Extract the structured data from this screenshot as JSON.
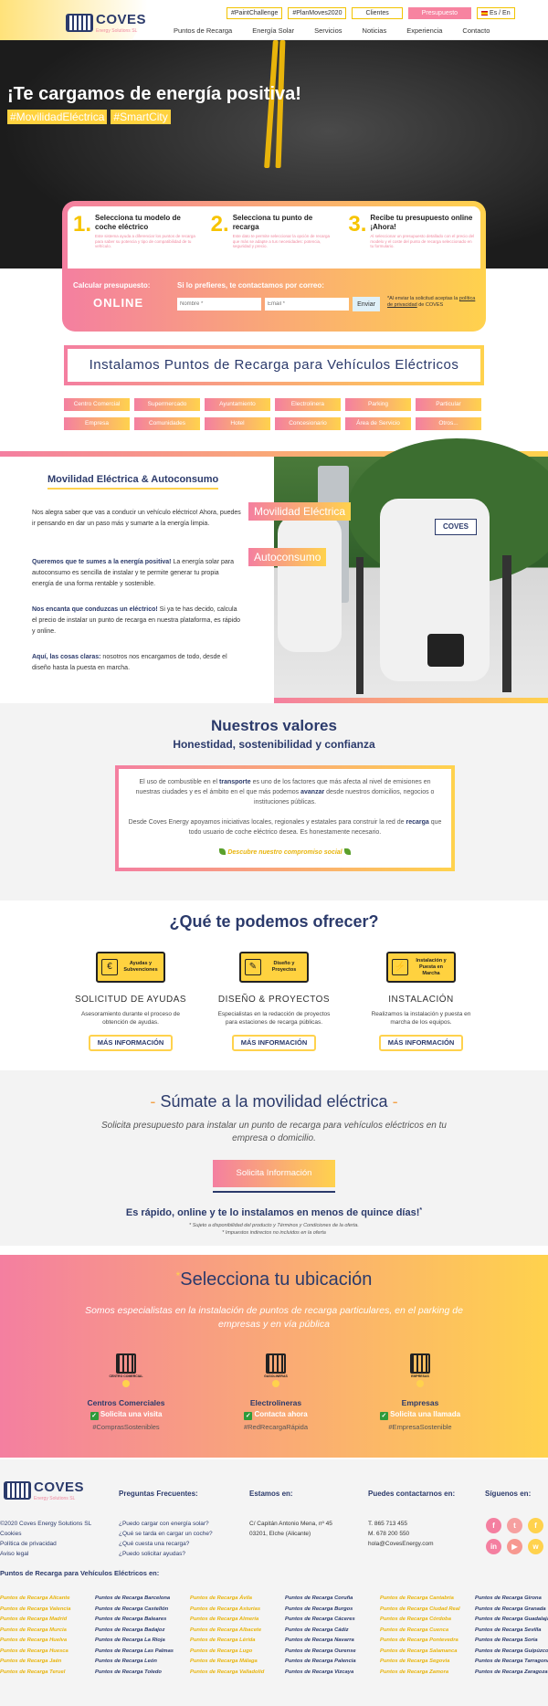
{
  "header": {
    "logo_text": "COVES",
    "logo_sub": "Energy Solutions SL",
    "top_buttons": [
      "#PaintChallenge",
      "#PlanMoves2020",
      "Clientes",
      "Presupuesto"
    ],
    "lang": "Es / En",
    "nav": [
      "Puntos de Recarga",
      "Energía Solar",
      "Servicios",
      "Noticias",
      "Experiencia",
      "Contacto"
    ]
  },
  "hero": {
    "title": "¡Te cargamos de energía positiva!",
    "tags": [
      "#MovilidadEléctrica",
      "#SmartCity"
    ]
  },
  "calculator": {
    "steps": [
      {
        "num": "1.",
        "title": "Selecciona tu modelo de coche eléctrico",
        "desc": "Este sistema ayuda a diferenciar los puntos de recarga para saber su potencia y tipo de compatibilidad de tu vehículo."
      },
      {
        "num": "2.",
        "title": "Selecciona tu punto de recarga",
        "desc": "Este dato te permite seleccionar la opción de recarga que más se adapte a tus necesidades: potencia, seguridad y precio."
      },
      {
        "num": "3.",
        "title": "Recibe tu presupuesto online ¡Ahora!",
        "desc": "Al seleccionar un presupuesto detallado con el precio del modelo y el coste del punto de recarga seleccionado en tu formulario."
      }
    ],
    "calc_label": "Calcular presupuesto:",
    "online": "ONLINE",
    "contact_label": "Si lo prefieres, te contactamos por correo:",
    "name_placeholder": "Nombre *",
    "email_placeholder": "Email *",
    "send": "Enviar",
    "note": "*Al enviar la solicitud aceptas la",
    "note_link": "política de privacidad",
    "note_end": "de COVES"
  },
  "instalamos": {
    "title": "Instalamos Puntos de Recarga para Vehículos Eléctricos",
    "categories": [
      "Centro Comercial",
      "Supermercado",
      "Ayuntamiento",
      "Electrolinera",
      "Parking",
      "Particular",
      "Empresa",
      "Comunidades",
      "Hotel",
      "Concesionario",
      "Área de Servicio",
      "Otros..."
    ]
  },
  "movilidad": {
    "title": "Movilidad Eléctrica & Autoconsumo",
    "p1": "Nos alegra saber que vas a conducir un vehículo eléctrico! Ahora, puedes ir pensando en dar un paso más y sumarte a la energía limpia.",
    "p2_bold": "Queremos que te sumes a la energía positiva!",
    "p2": " La energía solar para autoconsumo es sencilla de instalar y te permite generar tu propia energía de una forma rentable y sostenible.",
    "p3_bold": "Nos encanta que conduzcas un eléctrico!",
    "p3": " Si ya te has decido, calcula el precio de instalar un punto de recarga en nuestra plataforma, es rápido y online.",
    "p4_bold": "Aquí, las cosas claras:",
    "p4": " nosotros nos encargamos de todo, desde el diseño hasta la puesta en marcha.",
    "tag1": "Movilidad Eléctrica",
    "tag2": "Autoconsumo",
    "image_logo": "COVES"
  },
  "valores": {
    "title": "Nuestros valores",
    "subtitle": "Honestidad, sostenibilidad y confianza",
    "p1a": "El uso de combustible en el ",
    "p1b": "transporte",
    "p1c": " es uno de los factores que más afecta al nivel de emisiones en nuestras ciudades y es el ámbito en el que más podemos ",
    "p1d": "avanzar",
    "p1e": " desde nuestros domicilios, negocios o instituciones públicas.",
    "p2a": "Desde Coves Energy apoyamos iniciativas locales, regionales y estatales para construir la red de ",
    "p2b": "recarga",
    "p2c": " que todo usuario de coche eléctrico desea. Es honestamente necesario.",
    "link": "Descubre nuestro compromiso social"
  },
  "ofrecer": {
    "title": "¿Qué te podemos ofrecer?",
    "items": [
      {
        "icon_label": "Ayudas y Subvenciones",
        "glyph": "€",
        "head": "SOLICITUD DE AYUDAS",
        "desc": "Asesoramiento durante el proceso de obtención de ayudas.",
        "btn": "MÁS INFORMACIÓN"
      },
      {
        "icon_label": "Diseño y Proyectos",
        "glyph": "✎",
        "head": "DISEÑO & PROYECTOS",
        "desc": "Especialistas en la redacción de proyectos para estaciones de recarga públicas.",
        "btn": "MÁS INFORMACIÓN"
      },
      {
        "icon_label": "Instalación y Puesta en Marcha",
        "glyph": "⚡",
        "head": "INSTALACIÓN",
        "desc": "Realizamos la instalación y puesta en marcha de los equipos.",
        "btn": "MÁS INFORMACIÓN"
      }
    ]
  },
  "sumate": {
    "dash": "-",
    "title": "Súmate a la movilidad eléctrica",
    "desc": "Solicita presupuesto para instalar un punto de recarga para vehículos eléctricos en tu empresa o domicilio.",
    "button": "Solicita Información",
    "fast": "Es rápido, online y te lo instalamos en menos de quince días!",
    "fast_mark": "*",
    "note1": "* Sujeto a disponibilidad del producto y Términos y Condiciones de la oferta.",
    "note2": "* Impuestos indirectos no incluidos en la oferta"
  },
  "ubicacion": {
    "star": "*",
    "title": "Selecciona tu ubicación",
    "desc": "Somos especialistas en la instalación de puntos de recarga particulares, en el parking de empresas y en vía pública",
    "items": [
      {
        "icon_label": "CENTRO COMERCIAL",
        "name": "Centros Comerciales",
        "action": "Solicita una visita",
        "hash": "#ComprasSostenibles"
      },
      {
        "icon_label": "GASOLINERAS",
        "name": "Electrolineras",
        "action": "Contacta ahora",
        "hash": "#RedRecargaRápida"
      },
      {
        "icon_label": "EMPRESAS",
        "name": "Empresas",
        "action": "Solicita una llamada",
        "hash": "#EmpresaSostenible"
      }
    ],
    "check": "✓"
  },
  "footer": {
    "logo_text": "COVES",
    "logo_sub": "Energy Solutions SL",
    "col1": [
      "©2020 Coves Energy Solutions SL",
      "Cookies",
      "Política de privacidad",
      "Aviso legal"
    ],
    "faq_title": "Preguntas Frecuentes:",
    "faq": [
      "¿Puedo cargar con energía solar?",
      "¿Qué se tarda en cargar un coche?",
      "¿Qué cuesta una recarga?",
      "¿Puedo solicitar ayudas?"
    ],
    "addr_title": "Estamos en:",
    "addr": [
      "C/ Capitán Antonio Mena, nº 45",
      "03201, Elche (Alicante)"
    ],
    "contact_title": "Puedes contactarnos en:",
    "contact": [
      "T. 865 713 455",
      "M. 678 200 550",
      "hola@CovesEnergy.com"
    ],
    "social_title": "Síguenos en:",
    "social": [
      {
        "icon": "flickr-icon",
        "glyph": "f",
        "color": "#f47fa0"
      },
      {
        "icon": "twitter-icon",
        "glyph": "t",
        "color": "#f6a0a0"
      },
      {
        "icon": "facebook-icon",
        "glyph": "f",
        "color": "#ffd24d"
      },
      {
        "icon": "linkedin-icon",
        "glyph": "in",
        "color": "#f47fa0"
      },
      {
        "icon": "youtube-icon",
        "glyph": "▶",
        "color": "#f79890"
      },
      {
        "icon": "whatsapp-icon",
        "glyph": "w",
        "color": "#ffd24d"
      }
    ],
    "ptr_title": "Puntos de Recarga para Vehículos Eléctricos en:",
    "ptr": [
      "Puntos de Recarga Alicante",
      "Puntos de Recarga Barcelona",
      "Puntos de Recarga Ávila",
      "Puntos de Recarga Coruña",
      "Puntos de Recarga Cantabria",
      "Puntos de Recarga Girona",
      "Puntos de Recarga Valencia",
      "Puntos de Recarga Castellón",
      "Puntos de Recarga Asturias",
      "Puntos de Recarga Burgos",
      "Puntos de Recarga Ciudad Real",
      "Puntos de Recarga Granada",
      "Puntos de Recarga Madrid",
      "Puntos de Recarga Baleares",
      "Puntos de Recarga Almería",
      "Puntos de Recarga Cáceres",
      "Puntos de Recarga Córdoba",
      "Puntos de Recarga Guadalajara",
      "Puntos de Recarga Murcia",
      "Puntos de Recarga Badajoz",
      "Puntos de Recarga Albacete",
      "Puntos de Recarga Cádiz",
      "Puntos de Recarga Cuenca",
      "Puntos de Recarga Sevilla",
      "Puntos de Recarga Huelva",
      "Puntos de Recarga La Rioja",
      "Puntos de Recarga Lérida",
      "Puntos de Recarga Navarra",
      "Puntos de Recarga Pontevedra",
      "Puntos de Recarga Soria",
      "Puntos de Recarga Huesca",
      "Puntos de Recarga Las Palmas",
      "Puntos de Recarga Lugo",
      "Puntos de Recarga Ourense",
      "Puntos de Recarga Salamanca",
      "Puntos de Recarga Guipúzcoa",
      "Puntos de Recarga Jaén",
      "Puntos de Recarga León",
      "Puntos de Recarga Málaga",
      "Puntos de Recarga Palencia",
      "Puntos de Recarga Segovia",
      "Puntos de Recarga Tarragona",
      "Puntos de Recarga Teruel",
      "Puntos de Recarga Toledo",
      "Puntos de Recarga Valladolid",
      "Puntos de Recarga Vizcaya",
      "Puntos de Recarga Zamora",
      "Puntos de Recarga Zaragoza"
    ]
  }
}
